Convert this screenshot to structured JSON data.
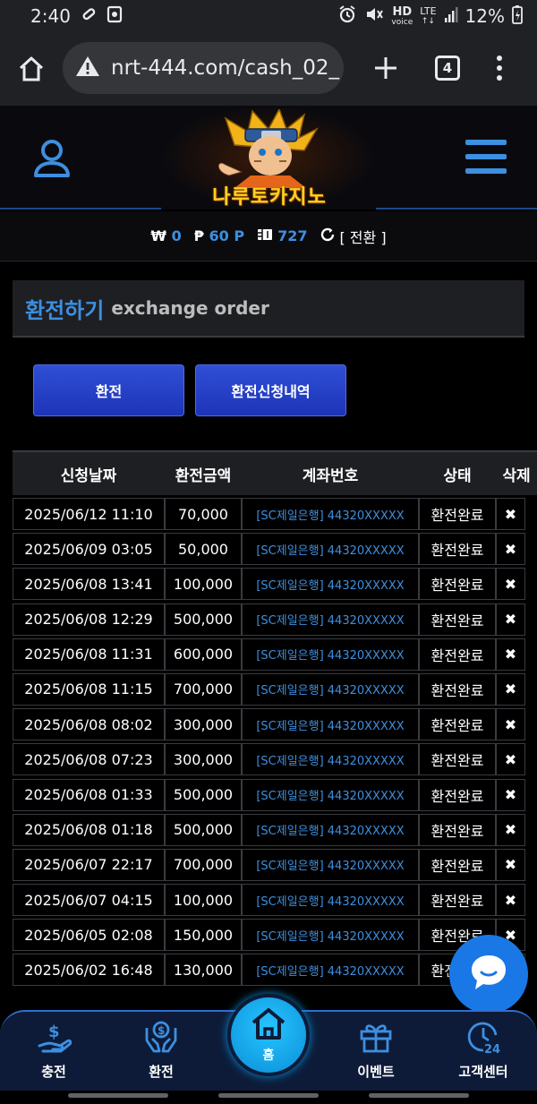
{
  "status_bar": {
    "time": "2:40",
    "hd_label": "HD",
    "voice_label": "voice",
    "lte_label": "LTE",
    "battery": "12%"
  },
  "browser": {
    "url": "nrt-444.com/cash_02_",
    "tab_count": "4"
  },
  "header": {
    "logo_text": "나루토카지노"
  },
  "balance": {
    "won_symbol": "₩",
    "won_value": "0",
    "point_symbol": "₱",
    "point_value": "60 P",
    "coupon_value": "727",
    "convert_label": "[ 전환 ]"
  },
  "section": {
    "title_ko": "환전하기",
    "title_en": "exchange order"
  },
  "buttons": {
    "exchange": "환전",
    "history": "환전신청내역"
  },
  "table": {
    "headers": {
      "date": "신청날짜",
      "amount": "환전금액",
      "account": "계좌번호",
      "status": "상태",
      "delete": "삭제"
    },
    "rows": [
      {
        "date": "2025/06/12 11:10",
        "amount": "70,000",
        "account": "[SC제일은행] 44320XXXXX",
        "status": "환전완료",
        "delete": "✖"
      },
      {
        "date": "2025/06/09 03:05",
        "amount": "50,000",
        "account": "[SC제일은행] 44320XXXXX",
        "status": "환전완료",
        "delete": "✖"
      },
      {
        "date": "2025/06/08 13:41",
        "amount": "100,000",
        "account": "[SC제일은행] 44320XXXXX",
        "status": "환전완료",
        "delete": "✖"
      },
      {
        "date": "2025/06/08 12:29",
        "amount": "500,000",
        "account": "[SC제일은행] 44320XXXXX",
        "status": "환전완료",
        "delete": "✖"
      },
      {
        "date": "2025/06/08 11:31",
        "amount": "600,000",
        "account": "[SC제일은행] 44320XXXXX",
        "status": "환전완료",
        "delete": "✖"
      },
      {
        "date": "2025/06/08 11:15",
        "amount": "700,000",
        "account": "[SC제일은행] 44320XXXXX",
        "status": "환전완료",
        "delete": "✖"
      },
      {
        "date": "2025/06/08 08:02",
        "amount": "300,000",
        "account": "[SC제일은행] 44320XXXXX",
        "status": "환전완료",
        "delete": "✖"
      },
      {
        "date": "2025/06/08 07:23",
        "amount": "300,000",
        "account": "[SC제일은행] 44320XXXXX",
        "status": "환전완료",
        "delete": "✖"
      },
      {
        "date": "2025/06/08 01:33",
        "amount": "500,000",
        "account": "[SC제일은행] 44320XXXXX",
        "status": "환전완료",
        "delete": "✖"
      },
      {
        "date": "2025/06/08 01:18",
        "amount": "500,000",
        "account": "[SC제일은행] 44320XXXXX",
        "status": "환전완료",
        "delete": "✖"
      },
      {
        "date": "2025/06/07 22:17",
        "amount": "700,000",
        "account": "[SC제일은행] 44320XXXXX",
        "status": "환전완료",
        "delete": "✖"
      },
      {
        "date": "2025/06/07 04:15",
        "amount": "100,000",
        "account": "[SC제일은행] 44320XXXXX",
        "status": "환전완료",
        "delete": "✖"
      },
      {
        "date": "2025/06/05 02:08",
        "amount": "150,000",
        "account": "[SC제일은행] 44320XXXXX",
        "status": "환전완료",
        "delete": "✖"
      },
      {
        "date": "2025/06/02 16:48",
        "amount": "130,000",
        "account": "[SC제일은행] 44320XXXXX",
        "status": "환전완료",
        "delete": "✖"
      }
    ]
  },
  "bottom_nav": {
    "charge": "충전",
    "exchange": "환전",
    "home": "홈",
    "event": "이벤트",
    "support": "고객센터"
  },
  "colors": {
    "accent_blue": "#3d8fe0",
    "button_blue": "#2f4fd6",
    "home_cyan": "#27c4ff"
  }
}
